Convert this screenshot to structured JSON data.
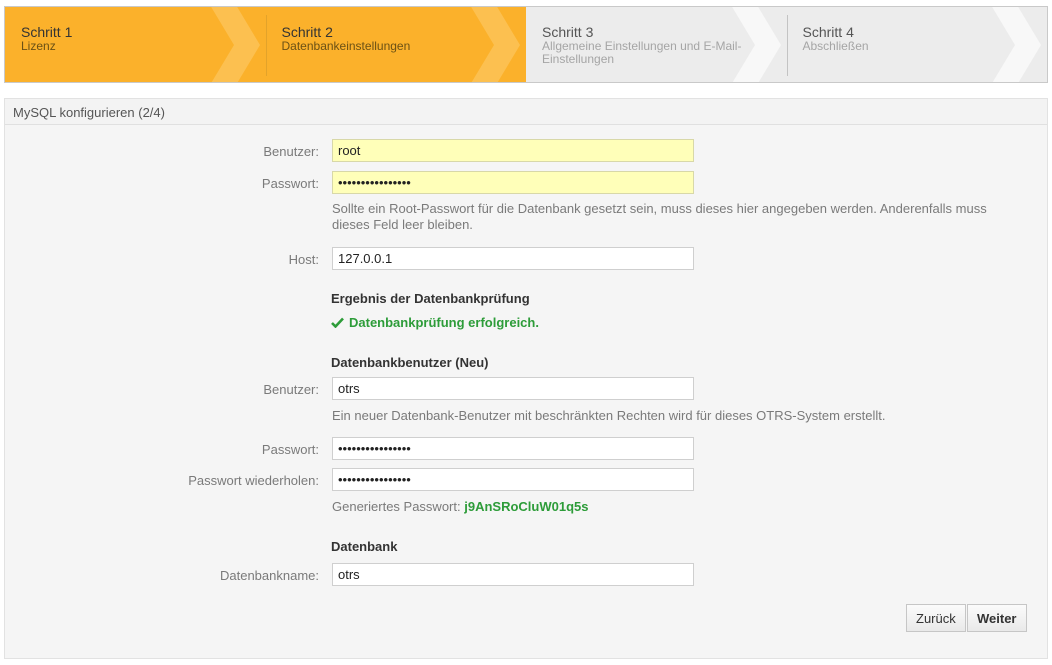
{
  "steps": [
    {
      "title": "Schritt 1",
      "subtitle": "Lizenz",
      "state": "done"
    },
    {
      "title": "Schritt 2",
      "subtitle": "Datenbankeinstellungen",
      "state": "active"
    },
    {
      "title": "Schritt 3",
      "subtitle": "Allgemeine Einstellungen und E-Mail-Einstellungen",
      "state": "pending"
    },
    {
      "title": "Schritt 4",
      "subtitle": "Abschließen",
      "state": "pending"
    }
  ],
  "panel": {
    "title": "MySQL konfigurieren (2/4)"
  },
  "root": {
    "user_label": "Benutzer:",
    "user_value": "root",
    "password_label": "Passwort:",
    "password_value": "••••••••••••••••",
    "password_hint": "Sollte ein Root-Passwort für die Datenbank gesetzt sein, muss dieses hier angegeben werden. Anderenfalls muss dieses Feld leer bleiben.",
    "host_label": "Host:",
    "host_value": "127.0.0.1"
  },
  "check": {
    "heading": "Ergebnis der Datenbankprüfung",
    "result": "Datenbankprüfung erfolgreich."
  },
  "new_user": {
    "heading": "Datenbankbenutzer (Neu)",
    "user_label": "Benutzer:",
    "user_value": "otrs",
    "user_hint": "Ein neuer Datenbank-Benutzer mit beschränkten Rechten wird für dieses OTRS-System erstellt.",
    "password_label": "Passwort:",
    "password_value": "••••••••••••••••",
    "password_repeat_label": "Passwort wiederholen:",
    "password_repeat_value": "••••••••••••••••",
    "generated_label": "Generiertes Passwort:",
    "generated_value": "j9AnSRoCluW01q5s"
  },
  "database": {
    "heading": "Datenbank",
    "name_label": "Datenbankname:",
    "name_value": "otrs"
  },
  "buttons": {
    "back": "Zurück",
    "next": "Weiter"
  },
  "colors": {
    "step_active": "#fbb12b",
    "step_inactive": "#ececec",
    "success": "#2d9c39",
    "autofill": "#ffffb9"
  }
}
